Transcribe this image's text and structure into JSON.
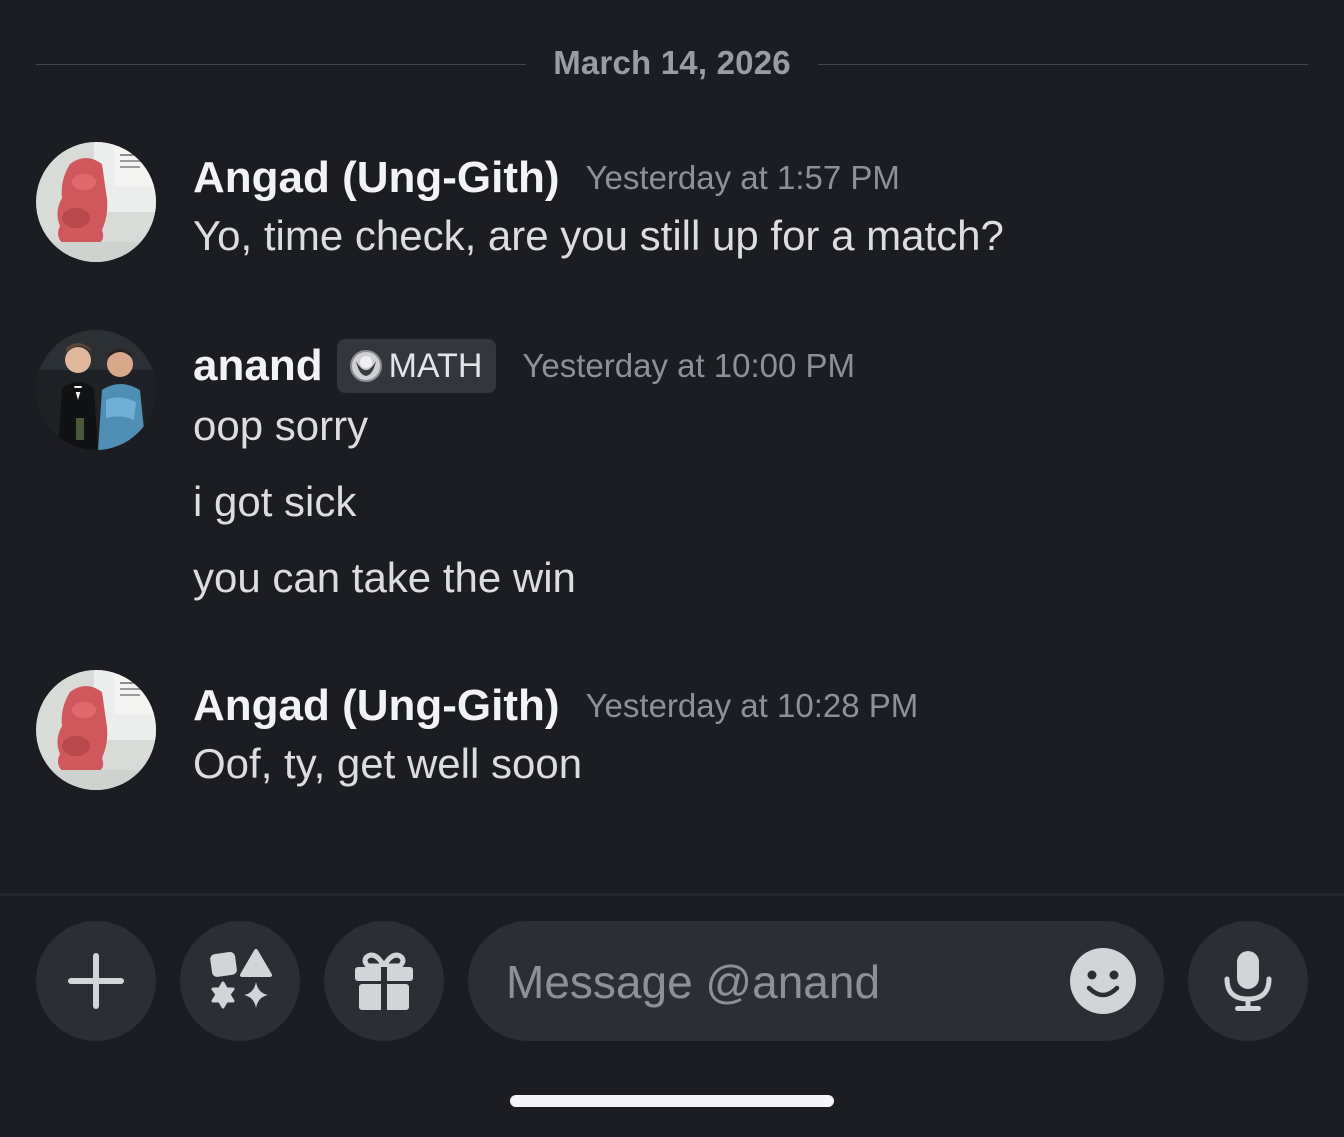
{
  "date_divider": "March 14, 2026",
  "messages": [
    {
      "author": "Angad (Ung-Gith)",
      "timestamp": "Yesterday at 1:57 PM",
      "lines": [
        "Yo, time check, are you still up for a match?"
      ]
    },
    {
      "author": "anand",
      "role_tag": "MATH",
      "timestamp": "Yesterday at 10:00 PM",
      "lines": [
        "oop sorry",
        "i got sick",
        "you can take the win"
      ]
    },
    {
      "author": "Angad (Ung-Gith)",
      "timestamp": "Yesterday at 10:28 PM",
      "lines": [
        "Oof, ty, get well soon"
      ]
    }
  ],
  "composer": {
    "placeholder": "Message @anand",
    "buttons": [
      "plus-icon",
      "apps-icon",
      "gift-icon",
      "emoji-icon",
      "microphone-icon"
    ]
  },
  "colors": {
    "background": "#1c1d22",
    "button_bg": "#2c2e35",
    "muted_text": "#8e9097"
  }
}
